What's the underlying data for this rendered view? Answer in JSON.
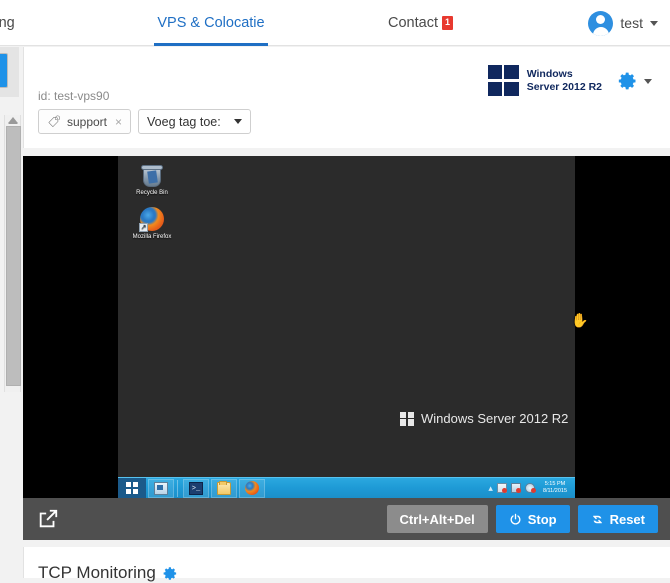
{
  "topnav": {
    "items": [
      {
        "label": "osting",
        "name": "nav-hosting",
        "active": false
      },
      {
        "label": "VPS & Colocatie",
        "name": "nav-vps",
        "active": true
      },
      {
        "label": "Contact",
        "name": "nav-contact",
        "active": false,
        "badge": "1"
      }
    ],
    "hosting_label": "osting",
    "vps_label": "VPS & Colocatie",
    "contact_label": "Contact",
    "contact_badge": "1",
    "user_name": "test",
    "active_color": "#1f6fc4",
    "badge_color": "#e8392f"
  },
  "vps": {
    "id_label": "id: test-vps90",
    "tag": {
      "label": "support",
      "remove_label": "×",
      "icon": "tag-icon"
    },
    "add_tag_label": "Voeg tag toe:",
    "os": {
      "line1": "Windows",
      "line2": "Server 2012 R2",
      "logo_color": "#10285e"
    },
    "settings_icon": "gear-icon",
    "settings_color": "#1f92e8"
  },
  "vnc": {
    "desktop_icons": [
      {
        "label": "Recycle Bin",
        "icon": "recycle-bin-icon"
      },
      {
        "label": "Mozilla Firefox",
        "icon": "firefox-icon"
      }
    ],
    "recycle_bin_label": "Recycle Bin",
    "firefox_label": "Mozilla Firefox",
    "watermark": "Windows Server 2012 R2",
    "cursor": "hand-cursor",
    "taskbar": {
      "start_icon": "windows-start-icon",
      "buttons": [
        {
          "name": "server-manager-icon"
        },
        {
          "name": "powershell-icon",
          "label": "⌫"
        },
        {
          "name": "file-explorer-icon"
        },
        {
          "name": "firefox-icon"
        }
      ],
      "powershell_glyph": ">_",
      "tray": {
        "overflow": "▴",
        "icons": [
          "action-center-icon",
          "network-icon",
          "volume-icon"
        ]
      },
      "clock_time": "5:15 PM",
      "clock_date": "8/11/2015"
    }
  },
  "controls": {
    "fullscreen_icon": "external-link-icon",
    "ctrl_alt_del_label": "Ctrl+Alt+Del",
    "stop_label": "Stop",
    "stop_icon": "power-icon",
    "reset_label": "Reset",
    "reset_icon": "refresh-icon",
    "blue": "#1f92e8",
    "grey": "#8c8c8c"
  },
  "bottom": {
    "title": "TCP Monitoring",
    "settings_icon": "gear-icon"
  }
}
